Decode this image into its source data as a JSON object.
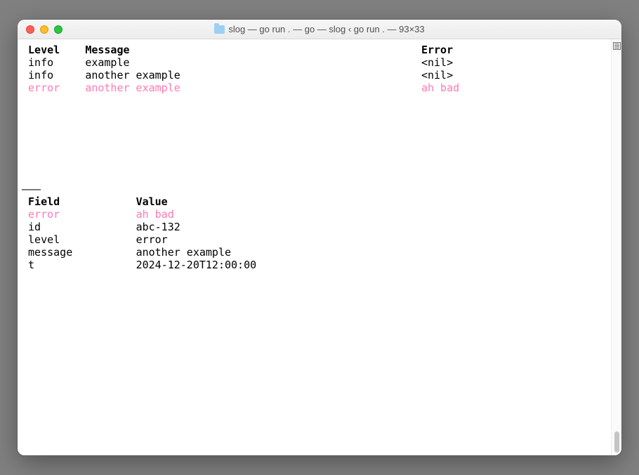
{
  "window": {
    "title": "slog — go run . — go — slog ‹ go run . — 93×33"
  },
  "table1": {
    "headers": {
      "level": "Level",
      "message": "Message",
      "error": "Error"
    },
    "rows": [
      {
        "level": "info",
        "message": "example",
        "error": "<nil>",
        "is_error": false
      },
      {
        "level": "info",
        "message": "another example",
        "error": "<nil>",
        "is_error": false
      },
      {
        "level": "error",
        "message": "another example",
        "error": "ah bad",
        "is_error": true
      }
    ]
  },
  "divider": "–––",
  "table2": {
    "headers": {
      "field": "Field",
      "value": "Value"
    },
    "rows": [
      {
        "field": "error",
        "value": "ah bad",
        "is_error": true
      },
      {
        "field": "id",
        "value": "abc-132",
        "is_error": false
      },
      {
        "field": "level",
        "value": "error",
        "is_error": false
      },
      {
        "field": "message",
        "value": "another example",
        "is_error": false
      },
      {
        "field": "t",
        "value": "2024-12-20T12:00:00",
        "is_error": false
      }
    ]
  },
  "layout": {
    "col1_width": 9,
    "col2_width": 53,
    "detail_col1_width": 17
  }
}
